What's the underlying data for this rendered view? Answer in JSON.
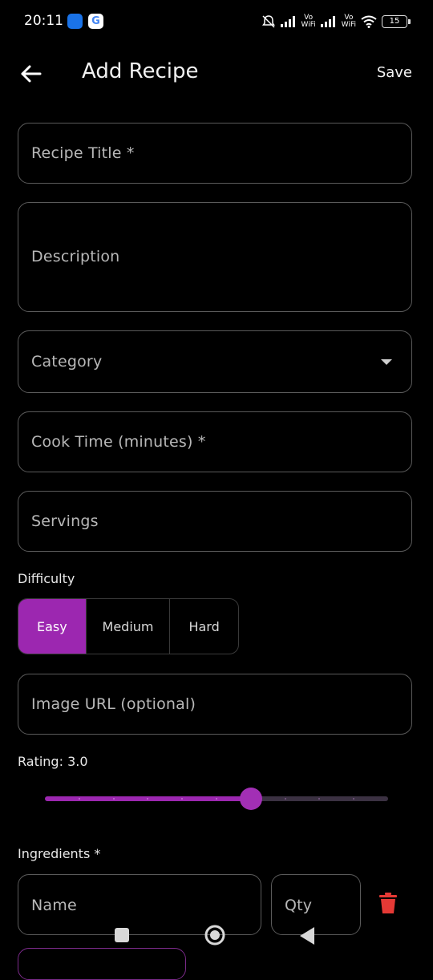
{
  "status_bar": {
    "time": "20:11",
    "network_vo_1": "Vo",
    "network_wifi_1": "WiFi",
    "network_vo_2": "Vo",
    "network_wifi_2": "WiFi",
    "battery": "15"
  },
  "app_bar": {
    "title": "Add Recipe",
    "save_label": "Save",
    "back_icon": "arrow-left-icon"
  },
  "form": {
    "title_placeholder": "Recipe Title *",
    "description_placeholder": "Description",
    "category_placeholder": "Category",
    "cook_time_placeholder": "Cook Time (minutes) *",
    "servings_placeholder": "Servings",
    "difficulty_label": "Difficulty",
    "difficulty_options": [
      "Easy",
      "Medium",
      "Hard"
    ],
    "difficulty_selected": "Easy",
    "image_url_placeholder": "Image URL (optional)",
    "rating_label": "Rating: 3.0",
    "rating_value": 3.0,
    "rating_max": 5.0,
    "ingredients_label": "Ingredients *",
    "ingredient_name_placeholder": "Name",
    "ingredient_qty_placeholder": "Qty"
  },
  "colors": {
    "accent": "#9c27b0",
    "delete": "#e53935",
    "background": "#000000"
  }
}
